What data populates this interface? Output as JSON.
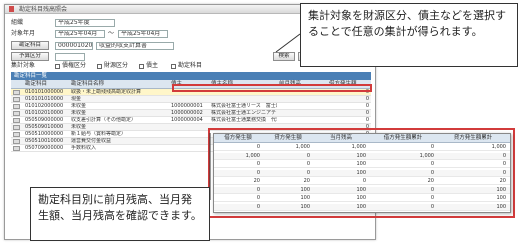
{
  "window": {
    "title": "勘定科目残高照会"
  },
  "form": {
    "org_label": "組織",
    "org_value": "平成25年度",
    "period_label": "対象年月",
    "period_from": "平成25年04月",
    "period_sep": "～",
    "period_to": "平成25年04月",
    "btn_account": "勘定科目",
    "account_code": "000001020",
    "account_name": "収益的収支計算書",
    "btn_fund": "予算区分",
    "btn_search": "検索",
    "btn_print": "出力",
    "agg_label": "集計対象",
    "chk1": "債権区分",
    "chk2": "財源区分",
    "chk3": "債主",
    "chk4": "勘定科目"
  },
  "section_title": "勘定科目一覧",
  "table": {
    "headers": [
      "勘定科目",
      "勘定科目名称",
      "債主",
      "債主名称",
      "前月残高",
      "借方発生額"
    ],
    "rows": [
      {
        "code": "010101000000",
        "name": "取扱・未上勘残残高勘定収計算",
        "party": "",
        "pname": "",
        "prev": "",
        "debit": "0"
      },
      {
        "code": "010101010000",
        "name": "現金",
        "party": "",
        "pname": "",
        "prev": "",
        "debit": "0"
      },
      {
        "code": "010102000000",
        "name": "未収金",
        "party": "1000000001",
        "pname": "株式会社富士通リース　富士通京",
        "prev": "",
        "debit": "0"
      },
      {
        "code": "010102010000",
        "name": "未収金",
        "party": "1000000002",
        "pname": "株式会社富士通エンジニアテック",
        "prev": "",
        "debit": "0"
      },
      {
        "code": "050509000000",
        "name": "収支差引計算（その他勘定）",
        "party": "1000000004",
        "pname": "株式会社富士通業務交換　代表社",
        "prev": "",
        "debit": "0"
      },
      {
        "code": "050509010000",
        "name": "未収金",
        "party": "",
        "pname": "",
        "prev": "",
        "debit": "0"
      },
      {
        "code": "050510000000",
        "name": "新１給与（賞料等勘定）",
        "party": "",
        "pname": "",
        "prev": "",
        "debit": "0"
      },
      {
        "code": "050510010000",
        "name": "運営費交付金収益",
        "party": "",
        "pname": "",
        "prev": "",
        "debit": "0"
      },
      {
        "code": "050709000000",
        "name": "手数料収入",
        "party": "",
        "pname": "",
        "prev": "",
        "debit": "0"
      }
    ]
  },
  "popup": {
    "headers": [
      "借方発生額",
      "貸方発生額",
      "当月残高",
      "借方発生額累計",
      "貸方発生額累計"
    ],
    "rows": [
      [
        "0",
        "1,000",
        "1,000",
        "0",
        "1,000"
      ],
      [
        "1,000",
        "0",
        "100",
        "1,000",
        "0"
      ],
      [
        "0",
        "0",
        "100",
        "0",
        "0"
      ],
      [
        "0",
        "0",
        "100",
        "0",
        "0"
      ],
      [
        "20",
        "20",
        "0",
        "20",
        "20"
      ],
      [
        "0",
        "100",
        "100",
        "0",
        "100"
      ],
      [
        "0",
        "100",
        "100",
        "0",
        "100"
      ],
      [
        "0",
        "100",
        "100",
        "0",
        "100"
      ]
    ]
  },
  "callouts": {
    "top": "集計対象を財源区分、債主などを選択することで任意の集計が得られます。",
    "bottom": "勘定科目別に前月残高、当月発生額、当月残高を確認できます。"
  },
  "colors": {
    "accent_red": "#d23b3b",
    "section_blue": "#4a7fb5",
    "header_blue": "#dce6f0"
  }
}
